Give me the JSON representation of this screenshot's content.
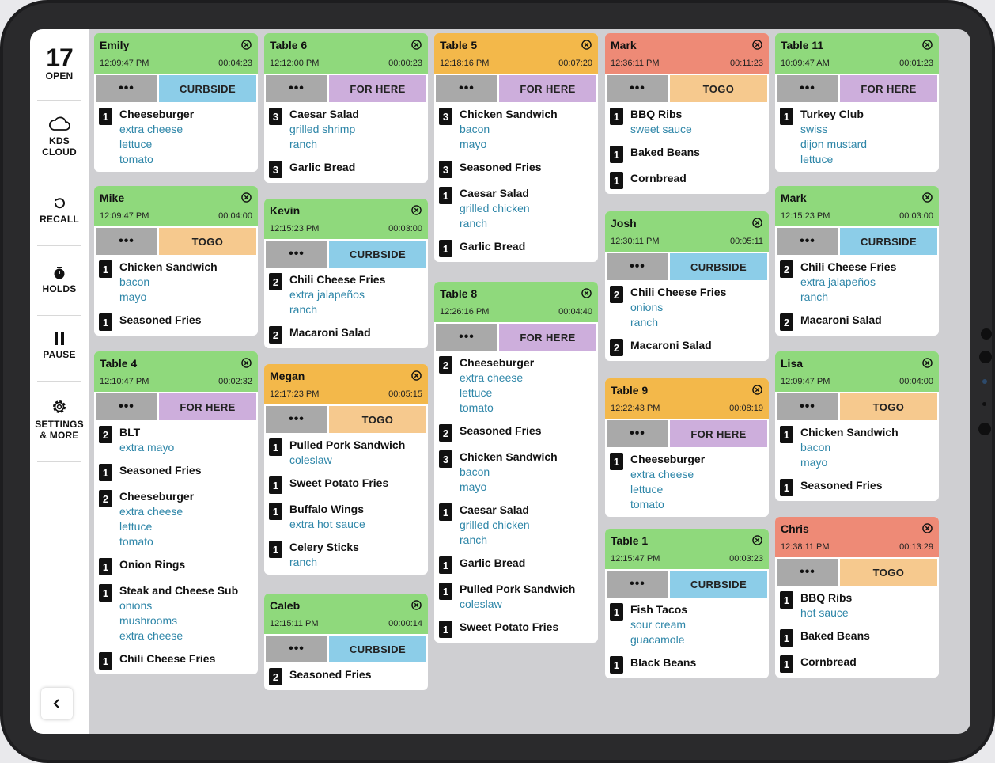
{
  "colors": {
    "green": "#8fd97c",
    "orange": "#f3b84a",
    "red": "#ee8a76",
    "curbside": "#8ccde8",
    "forhere": "#cdaedc",
    "togo": "#f6c98e"
  },
  "sidebar": {
    "open_count": "17",
    "open_label": "OPEN",
    "cloud_label_1": "KDS",
    "cloud_label_2": "CLOUD",
    "recall_label": "RECALL",
    "holds_label": "HOLDS",
    "pause_label": "PAUSE",
    "settings_label_1": "SETTINGS",
    "settings_label_2": "& MORE"
  },
  "tickets": [
    {
      "id": "emily",
      "name": "Emily",
      "time": "12:09:47 PM",
      "elapsed": "00:04:23",
      "color": "green",
      "more": "•••",
      "type": "CURBSIDE",
      "type_color": "curbside",
      "items": [
        {
          "qty": "1",
          "name": "Cheeseburger",
          "mods": [
            "extra cheese",
            "lettuce",
            "tomato"
          ]
        }
      ]
    },
    {
      "id": "mike",
      "name": "Mike",
      "time": "12:09:47 PM",
      "elapsed": "00:04:00",
      "color": "green",
      "more": "•••",
      "type": "TOGO",
      "type_color": "togo",
      "items": [
        {
          "qty": "1",
          "name": "Chicken Sandwich",
          "mods": [
            "bacon",
            "mayo"
          ]
        },
        {
          "qty": "1",
          "name": "Seasoned Fries",
          "mods": []
        }
      ]
    },
    {
      "id": "table4",
      "name": "Table 4",
      "time": "12:10:47 PM",
      "elapsed": "00:02:32",
      "color": "green",
      "more": "•••",
      "type": "FOR HERE",
      "type_color": "forhere",
      "items": [
        {
          "qty": "2",
          "name": "BLT",
          "mods": [
            "extra mayo"
          ]
        },
        {
          "qty": "1",
          "name": "Seasoned Fries",
          "mods": []
        },
        {
          "qty": "2",
          "name": "Cheeseburger",
          "mods": [
            "extra cheese",
            "lettuce",
            "tomato"
          ]
        },
        {
          "qty": "1",
          "name": "Onion Rings",
          "mods": []
        },
        {
          "qty": "1",
          "name": "Steak and Cheese Sub",
          "mods": [
            "onions",
            "mushrooms",
            "extra cheese"
          ]
        },
        {
          "qty": "1",
          "name": "Chili Cheese Fries",
          "mods": []
        }
      ]
    },
    {
      "id": "table6",
      "name": "Table 6",
      "time": "12:12:00 PM",
      "elapsed": "00:00:23",
      "color": "green",
      "more": "•••",
      "type": "FOR HERE",
      "type_color": "forhere",
      "items": [
        {
          "qty": "3",
          "name": "Caesar Salad",
          "mods": [
            "grilled shrimp",
            "ranch"
          ]
        },
        {
          "qty": "3",
          "name": "Garlic Bread",
          "mods": []
        }
      ]
    },
    {
      "id": "kevin",
      "name": "Kevin",
      "time": "12:15:23 PM",
      "elapsed": "00:03:00",
      "color": "green",
      "more": "•••",
      "type": "CURBSIDE",
      "type_color": "curbside",
      "items": [
        {
          "qty": "2",
          "name": "Chili Cheese Fries",
          "mods": [
            "extra jalapeños",
            "ranch"
          ]
        },
        {
          "qty": "2",
          "name": "Macaroni Salad",
          "mods": []
        }
      ]
    },
    {
      "id": "megan",
      "name": "Megan",
      "time": "12:17:23 PM",
      "elapsed": "00:05:15",
      "color": "orange",
      "more": "•••",
      "type": "TOGO",
      "type_color": "togo",
      "items": [
        {
          "qty": "1",
          "name": "Pulled Pork Sandwich",
          "mods": [
            "coleslaw"
          ]
        },
        {
          "qty": "1",
          "name": "Sweet Potato Fries",
          "mods": []
        },
        {
          "qty": "1",
          "name": "Buffalo Wings",
          "mods": [
            "extra hot sauce"
          ]
        },
        {
          "qty": "1",
          "name": "Celery Sticks",
          "mods": [
            "ranch"
          ]
        }
      ]
    },
    {
      "id": "caleb",
      "name": "Caleb",
      "time": "12:15:11 PM",
      "elapsed": "00:00:14",
      "color": "green",
      "more": "•••",
      "type": "CURBSIDE",
      "type_color": "curbside",
      "items": [
        {
          "qty": "2",
          "name": "Seasoned Fries",
          "mods": []
        }
      ]
    },
    {
      "id": "table5",
      "name": "Table 5",
      "time": "12:18:16 PM",
      "elapsed": "00:07:20",
      "color": "orange",
      "more": "•••",
      "type": "FOR HERE",
      "type_color": "forhere",
      "items": [
        {
          "qty": "3",
          "name": "Chicken Sandwich",
          "mods": [
            "bacon",
            "mayo"
          ]
        },
        {
          "qty": "3",
          "name": "Seasoned Fries",
          "mods": []
        },
        {
          "qty": "1",
          "name": "Caesar Salad",
          "mods": [
            "grilled chicken",
            "ranch"
          ]
        },
        {
          "qty": "1",
          "name": "Garlic Bread",
          "mods": []
        }
      ]
    },
    {
      "id": "table8",
      "name": "Table 8",
      "time": "12:26:16 PM",
      "elapsed": "00:04:40",
      "color": "green",
      "more": "•••",
      "type": "FOR HERE",
      "type_color": "forhere",
      "items": [
        {
          "qty": "2",
          "name": "Cheeseburger",
          "mods": [
            "extra cheese",
            "lettuce",
            "tomato"
          ]
        },
        {
          "qty": "2",
          "name": "Seasoned Fries",
          "mods": []
        },
        {
          "qty": "3",
          "name": "Chicken Sandwich",
          "mods": [
            "bacon",
            "mayo"
          ]
        },
        {
          "qty": "1",
          "name": "Caesar Salad",
          "mods": [
            "grilled chicken",
            "ranch"
          ]
        },
        {
          "qty": "1",
          "name": "Garlic Bread",
          "mods": []
        },
        {
          "qty": "1",
          "name": "Pulled Pork Sandwich",
          "mods": [
            "coleslaw"
          ]
        },
        {
          "qty": "1",
          "name": "Sweet Potato Fries",
          "mods": []
        }
      ]
    },
    {
      "id": "mark1",
      "name": "Mark",
      "time": "12:36:11 PM",
      "elapsed": "00:11:23",
      "color": "red",
      "more": "•••",
      "type": "TOGO",
      "type_color": "togo",
      "items": [
        {
          "qty": "1",
          "name": "BBQ Ribs",
          "mods": [
            "sweet sauce"
          ]
        },
        {
          "qty": "1",
          "name": "Baked Beans",
          "mods": []
        },
        {
          "qty": "1",
          "name": "Cornbread",
          "mods": []
        }
      ]
    },
    {
      "id": "josh",
      "name": "Josh",
      "time": "12:30:11 PM",
      "elapsed": "00:05:11",
      "color": "green",
      "more": "•••",
      "type": "CURBSIDE",
      "type_color": "curbside",
      "items": [
        {
          "qty": "2",
          "name": "Chili Cheese Fries",
          "mods": [
            "onions",
            "ranch"
          ]
        },
        {
          "qty": "2",
          "name": "Macaroni Salad",
          "mods": []
        }
      ]
    },
    {
      "id": "table9",
      "name": "Table 9",
      "time": "12:22:43 PM",
      "elapsed": "00:08:19",
      "color": "orange",
      "more": "•••",
      "type": "FOR HERE",
      "type_color": "forhere",
      "items": [
        {
          "qty": "1",
          "name": "Cheeseburger",
          "mods": [
            "extra cheese",
            "lettuce",
            "tomato"
          ]
        }
      ]
    },
    {
      "id": "table1",
      "name": "Table 1",
      "time": "12:15:47 PM",
      "elapsed": "00:03:23",
      "color": "green",
      "more": "•••",
      "type": "CURBSIDE",
      "type_color": "curbside",
      "items": [
        {
          "qty": "1",
          "name": "Fish Tacos",
          "mods": [
            "sour cream",
            "guacamole"
          ]
        },
        {
          "qty": "1",
          "name": "Black Beans",
          "mods": []
        }
      ]
    },
    {
      "id": "table11",
      "name": "Table 11",
      "time": "10:09:47 AM",
      "elapsed": "00:01:23",
      "color": "green",
      "more": "•••",
      "type": "FOR HERE",
      "type_color": "forhere",
      "items": [
        {
          "qty": "1",
          "name": "Turkey Club",
          "mods": [
            "swiss",
            "dijon mustard",
            "lettuce"
          ]
        }
      ]
    },
    {
      "id": "mark2",
      "name": "Mark",
      "time": "12:15:23 PM",
      "elapsed": "00:03:00",
      "color": "green",
      "more": "•••",
      "type": "CURBSIDE",
      "type_color": "curbside",
      "items": [
        {
          "qty": "2",
          "name": "Chili Cheese Fries",
          "mods": [
            "extra jalapeños",
            "ranch"
          ]
        },
        {
          "qty": "2",
          "name": "Macaroni Salad",
          "mods": []
        }
      ]
    },
    {
      "id": "lisa",
      "name": "Lisa",
      "time": "12:09:47 PM",
      "elapsed": "00:04:00",
      "color": "green",
      "more": "•••",
      "type": "TOGO",
      "type_color": "togo",
      "items": [
        {
          "qty": "1",
          "name": "Chicken Sandwich",
          "mods": [
            "bacon",
            "mayo"
          ]
        },
        {
          "qty": "1",
          "name": "Seasoned Fries",
          "mods": []
        }
      ]
    },
    {
      "id": "chris",
      "name": "Chris",
      "time": "12:38:11 PM",
      "elapsed": "00:13:29",
      "color": "red",
      "more": "•••",
      "type": "TOGO",
      "type_color": "togo",
      "items": [
        {
          "qty": "1",
          "name": "BBQ Ribs",
          "mods": [
            "hot sauce"
          ]
        },
        {
          "qty": "1",
          "name": "Baked Beans",
          "mods": []
        },
        {
          "qty": "1",
          "name": "Cornbread",
          "mods": []
        }
      ]
    }
  ]
}
